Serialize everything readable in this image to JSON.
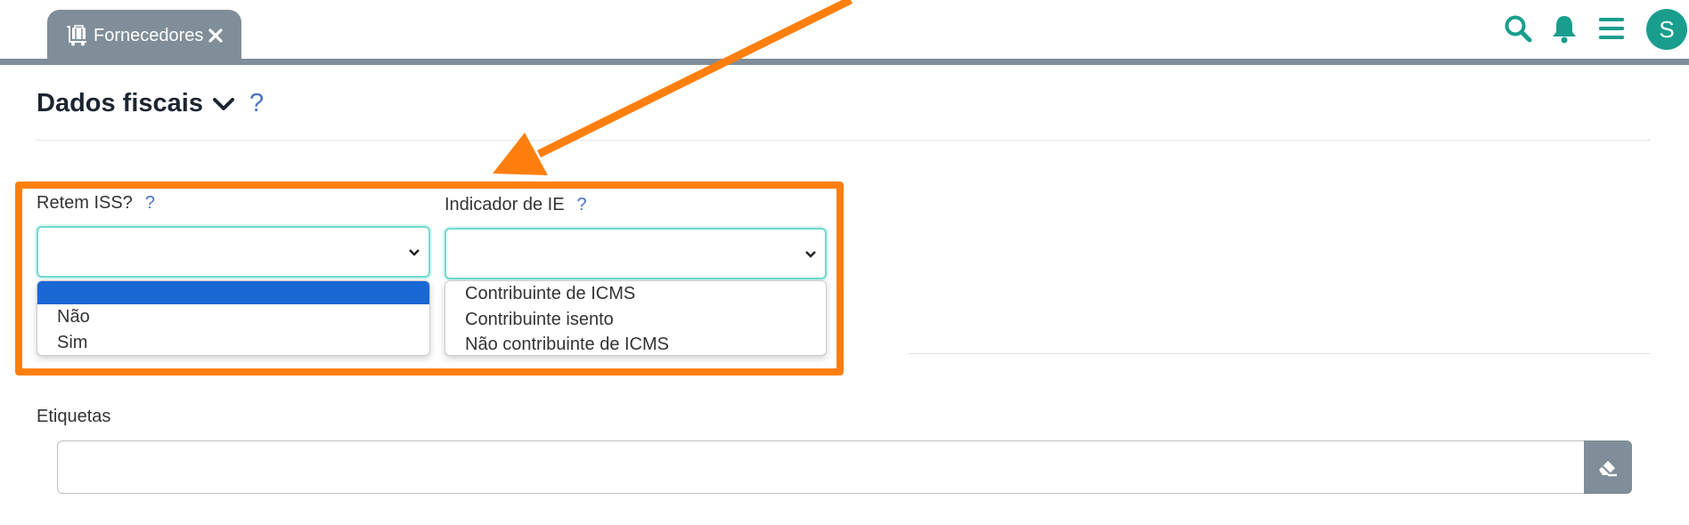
{
  "topbar": {
    "tab_label": "Fornecedores",
    "avatar_letter": "S"
  },
  "section": {
    "title": "Dados fiscais",
    "help": "?"
  },
  "retem_iss": {
    "label": "Retem ISS?",
    "help": "?",
    "value": "",
    "options": [
      "",
      "Não",
      "Sim"
    ]
  },
  "indicador_ie": {
    "label": "Indicador de IE",
    "help": "?",
    "value": "",
    "options": [
      "Contribuinte de ICMS",
      "Contribuinte isento",
      "Não contribuinte de ICMS"
    ]
  },
  "etiquetas": {
    "label": "Etiquetas",
    "value": ""
  },
  "colors": {
    "accent": "#199e8e",
    "tab": "#7f8e98",
    "highlight": "#ff7f0e",
    "selected_option": "#1967d2",
    "help": "#4b70c6"
  }
}
